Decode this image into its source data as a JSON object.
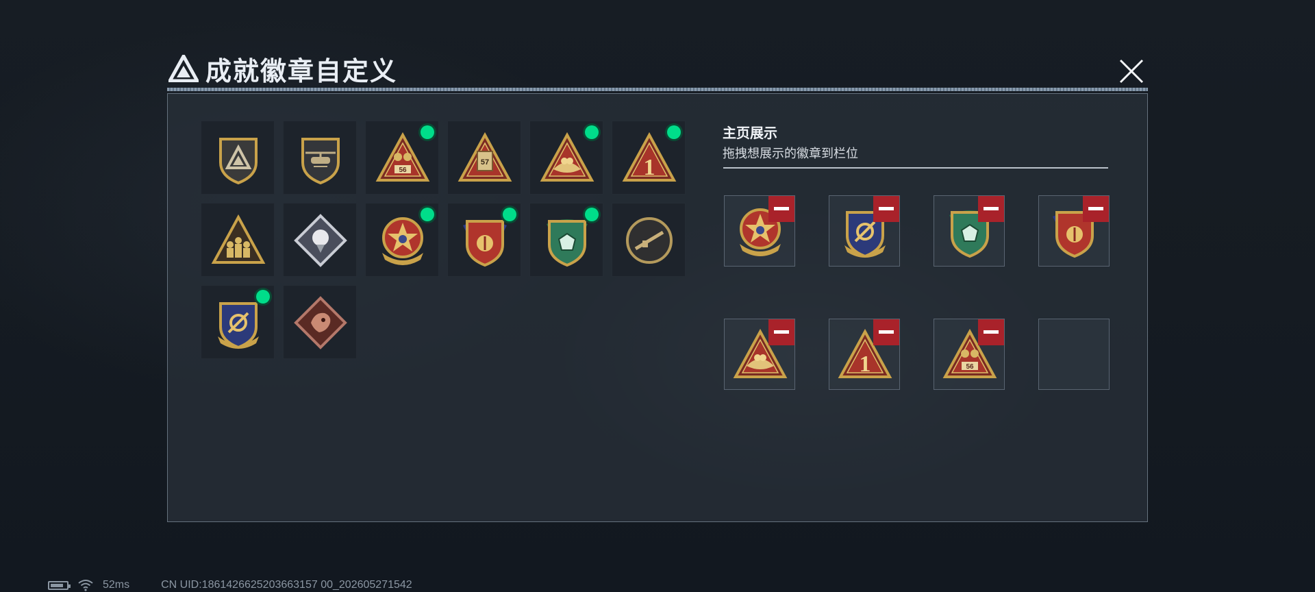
{
  "window": {
    "title": "成就徽章自定义",
    "title_icon": "triangle-logo-icon",
    "close_icon": "close-icon"
  },
  "badges": [
    {
      "id": "b1",
      "icon": "triangle-shield-badge",
      "equipped": false
    },
    {
      "id": "b2",
      "icon": "helicopter-shield-badge",
      "equipped": false
    },
    {
      "id": "b3",
      "icon": "triangle-56-badge",
      "equipped": true
    },
    {
      "id": "b4",
      "icon": "triangle-57-badge",
      "equipped": false
    },
    {
      "id": "b5",
      "icon": "triangle-wings-badge",
      "equipped": true
    },
    {
      "id": "b6",
      "icon": "triangle-number-one-badge",
      "equipped": true
    },
    {
      "id": "b7",
      "icon": "triangle-soldiers-badge",
      "equipped": false
    },
    {
      "id": "b8",
      "icon": "diamond-rose-badge",
      "equipped": false
    },
    {
      "id": "b9",
      "icon": "star-medal-badge",
      "equipped": true
    },
    {
      "id": "b10",
      "icon": "ribbon-shield-badge",
      "equipped": true
    },
    {
      "id": "b11",
      "icon": "green-gem-shield-badge",
      "equipped": true
    },
    {
      "id": "b12",
      "icon": "rifle-shield-badge",
      "equipped": false
    },
    {
      "id": "b13",
      "icon": "anchor-shield-badge",
      "equipped": true
    },
    {
      "id": "b14",
      "icon": "diamond-dragon-badge",
      "equipped": false
    }
  ],
  "sidebar": {
    "title": "主页展示",
    "subtitle": "拖拽想展示的徽章到栏位"
  },
  "display_slots": [
    {
      "badge": "star-medal-badge"
    },
    {
      "badge": "anchor-shield-badge"
    },
    {
      "badge": "green-gem-shield-badge"
    },
    {
      "badge": "ribbon-shield-badge"
    },
    {
      "badge": "triangle-wings-badge"
    },
    {
      "badge": "triangle-number-one-badge"
    },
    {
      "badge": "triangle-56-badge"
    },
    {
      "badge": null
    }
  ],
  "status_bar": {
    "battery_icon": "battery-icon",
    "wifi_icon": "wifi-icon",
    "ping": "52ms",
    "uid": "CN UID:1861426625203663157 00_202605271542"
  },
  "colors": {
    "equipped_dot": "#00dd8a",
    "remove_button": "#a9222a",
    "gold": "#c9a24a"
  }
}
